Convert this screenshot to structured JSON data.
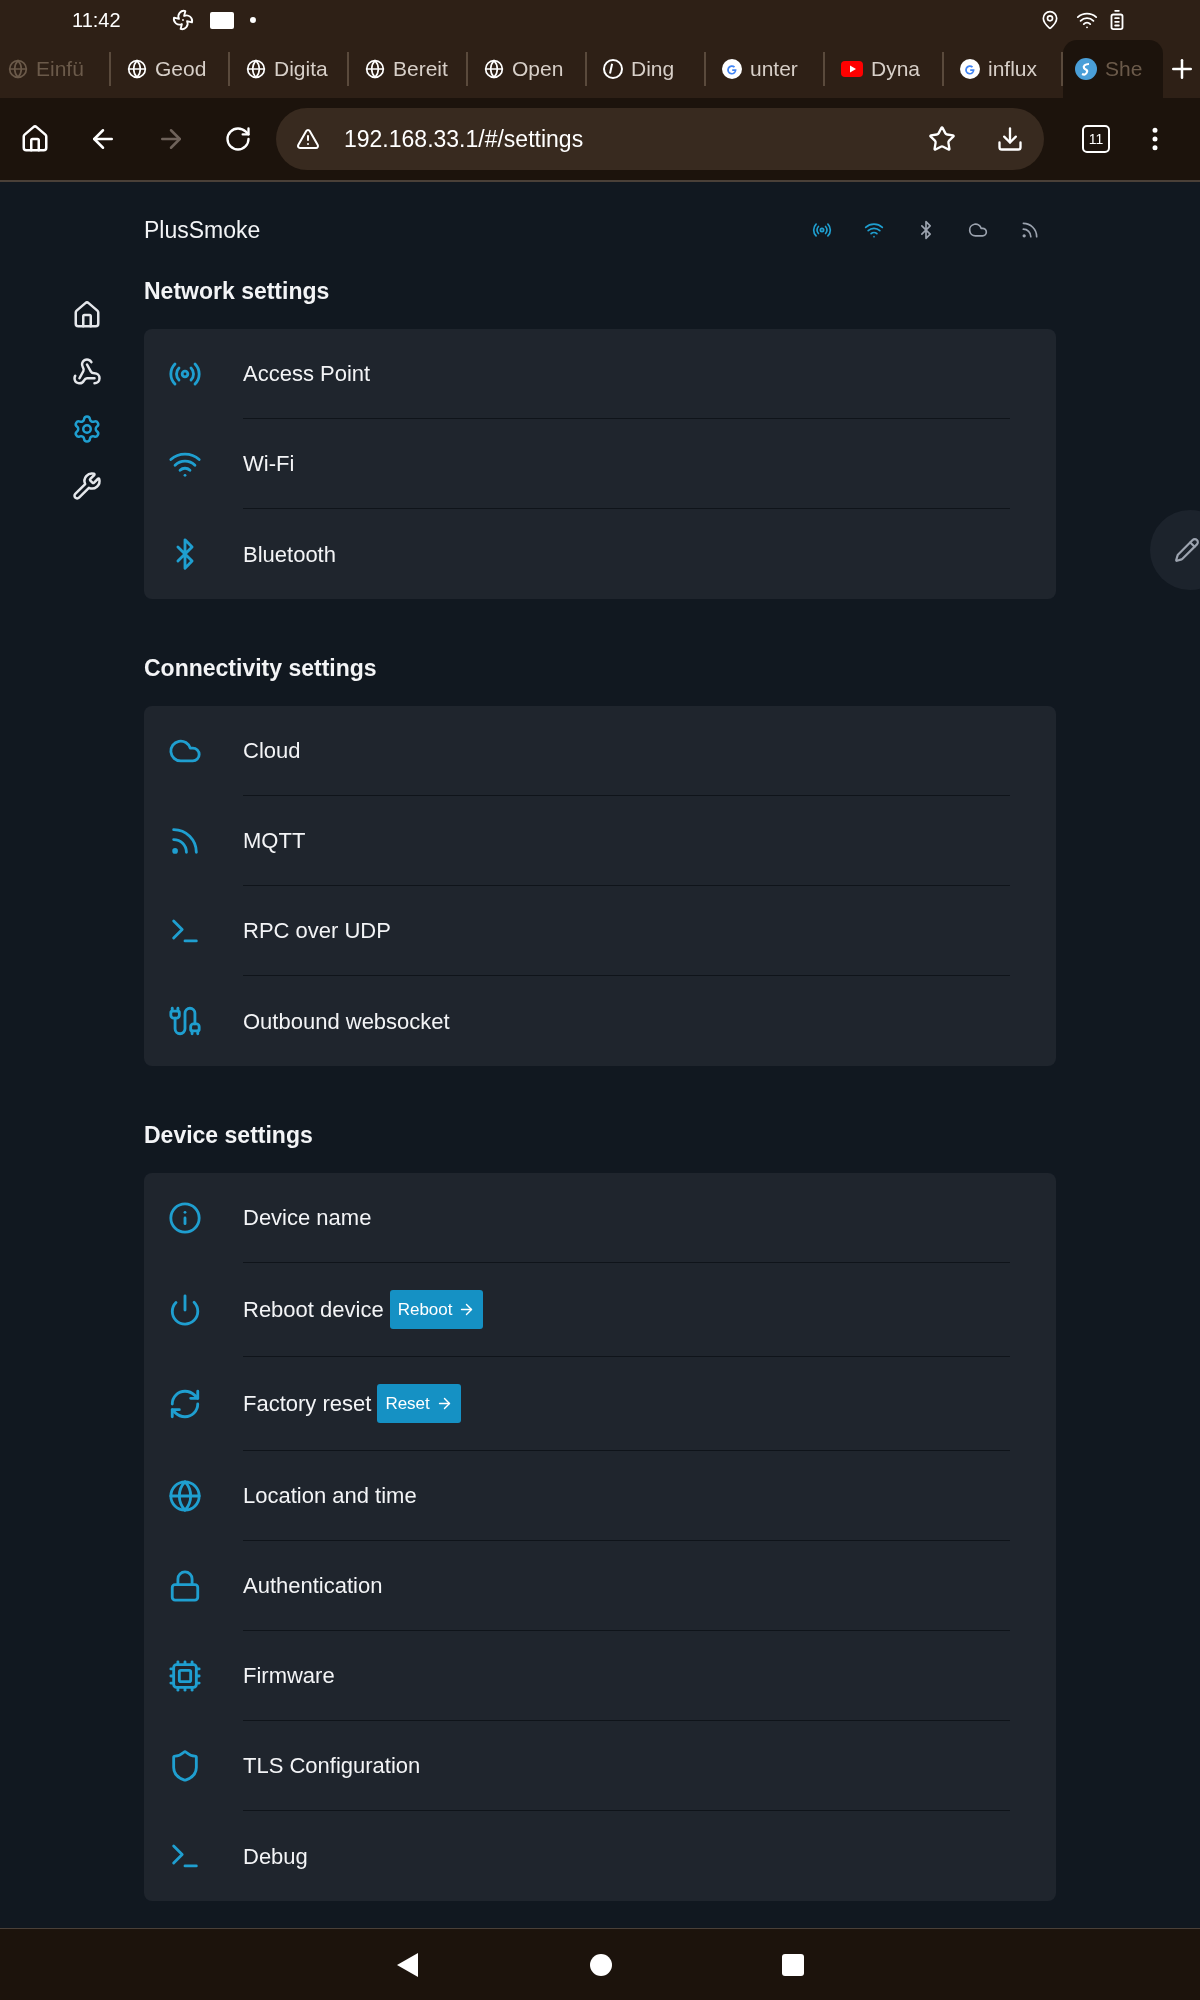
{
  "status_bar": {
    "time": "11:42"
  },
  "tabs": [
    {
      "label": "Einfü",
      "kind": "faded",
      "selected": false
    },
    {
      "label": "Geod",
      "kind": "globe",
      "selected": false
    },
    {
      "label": "Digita",
      "kind": "globe",
      "selected": false
    },
    {
      "label": "Bereit",
      "kind": "globe",
      "selected": false
    },
    {
      "label": "Open",
      "kind": "globe",
      "selected": false
    },
    {
      "label": "Ding",
      "kind": "at",
      "selected": false
    },
    {
      "label": "unter",
      "kind": "google",
      "selected": false
    },
    {
      "label": "Dyna",
      "kind": "youtube",
      "selected": false
    },
    {
      "label": "influx",
      "kind": "google",
      "selected": false
    },
    {
      "label": "She",
      "kind": "site",
      "selected": true
    }
  ],
  "toolbar": {
    "url": "192.168.33.1/#/settings",
    "tab_count": "11"
  },
  "app": {
    "title": "PlusSmoke",
    "status_icons": [
      {
        "kind": "ap",
        "active": true
      },
      {
        "kind": "wifi",
        "active": true
      },
      {
        "kind": "bluetooth",
        "active": false
      },
      {
        "kind": "cloud",
        "active": false
      },
      {
        "kind": "mqtt",
        "active": false
      }
    ],
    "nav": [
      {
        "kind": "home",
        "selected": false
      },
      {
        "kind": "webhook",
        "selected": false
      },
      {
        "kind": "settings",
        "selected": true
      },
      {
        "kind": "tools",
        "selected": false
      }
    ],
    "sections": [
      {
        "title": "Network settings",
        "items": [
          {
            "label": "Access Point",
            "kind": "ap"
          },
          {
            "label": "Wi-Fi",
            "kind": "wifi"
          },
          {
            "label": "Bluetooth",
            "kind": "bluetooth"
          }
        ]
      },
      {
        "title": "Connectivity settings",
        "items": [
          {
            "label": "Cloud",
            "kind": "cloud"
          },
          {
            "label": "MQTT",
            "kind": "mqtt"
          },
          {
            "label": "RPC over UDP",
            "kind": "terminal"
          },
          {
            "label": "Outbound websocket",
            "kind": "websocket"
          }
        ]
      },
      {
        "title": "Device settings",
        "items": [
          {
            "label": "Device name",
            "kind": "info"
          },
          {
            "label": "Reboot device",
            "kind": "power",
            "button": "Reboot"
          },
          {
            "label": "Factory reset",
            "kind": "reset",
            "button": "Reset"
          },
          {
            "label": "Location and time",
            "kind": "globe"
          },
          {
            "label": "Authentication",
            "kind": "lock"
          },
          {
            "label": "Firmware",
            "kind": "chip"
          },
          {
            "label": "TLS Configuration",
            "kind": "shield"
          },
          {
            "label": "Debug",
            "kind": "terminal"
          }
        ]
      }
    ]
  }
}
